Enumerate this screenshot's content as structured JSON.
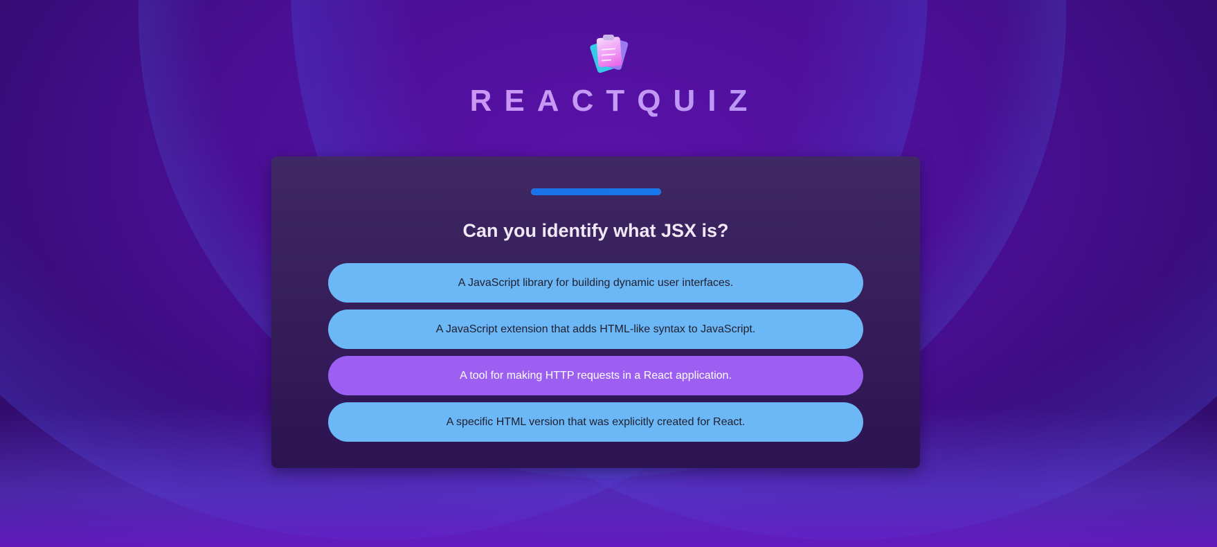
{
  "app": {
    "title": "REACTQUIZ",
    "logo_icon": "quiz-clipboard-icon"
  },
  "quiz": {
    "progress": 1.0,
    "question": "Can you identify what JSX is?",
    "options": [
      {
        "label": "A JavaScript library for building dynamic user interfaces."
      },
      {
        "label": "A JavaScript extension that adds HTML-like syntax to JavaScript."
      },
      {
        "label": "A tool for making HTTP requests in a React application.",
        "state": "hover"
      },
      {
        "label": "A specific HTML version that was explicitly created for React."
      }
    ]
  },
  "colors": {
    "option_bg": "#6cb7f5",
    "option_hover_bg": "#9c5ff2",
    "progress_fill": "#1a73e8",
    "card_bg": "#3a2460"
  }
}
